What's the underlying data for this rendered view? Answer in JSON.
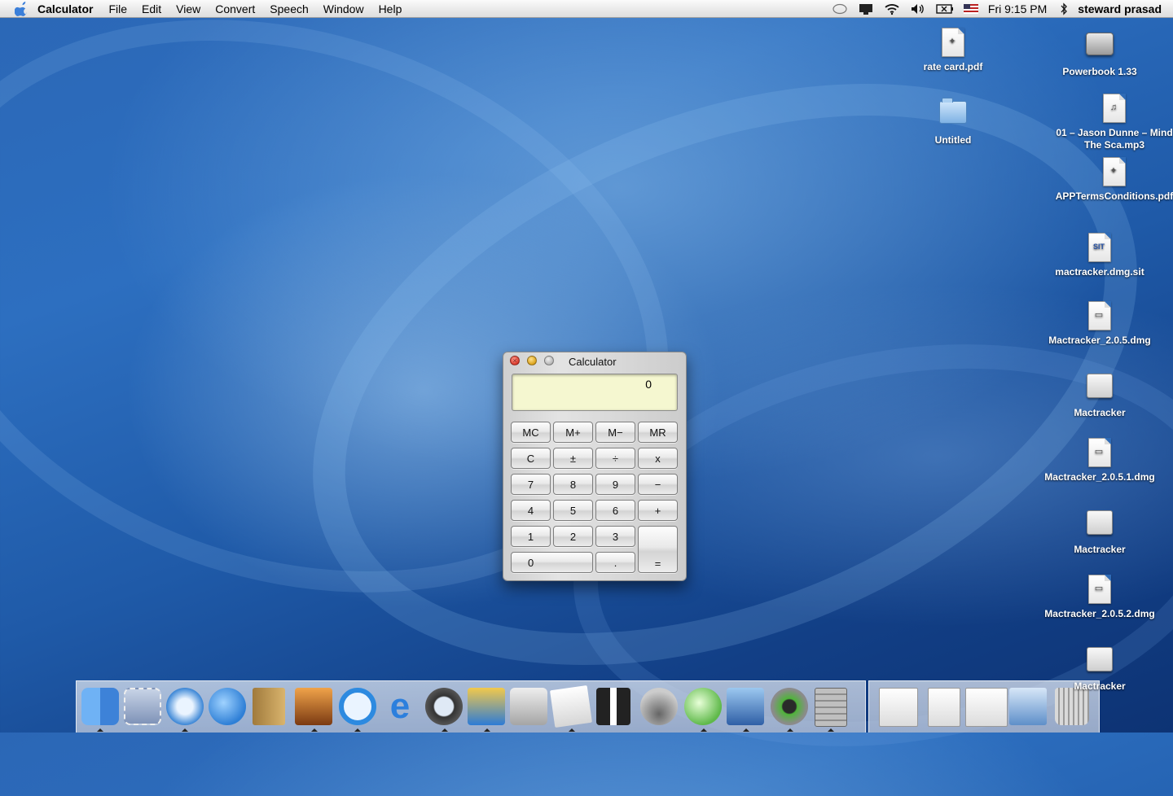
{
  "menubar": {
    "app_name": "Calculator",
    "menus": [
      "File",
      "Edit",
      "View",
      "Convert",
      "Speech",
      "Window",
      "Help"
    ],
    "clock": "Fri 9:15 PM",
    "user": "steward prasad",
    "status_icons": [
      "sync-icon",
      "display-icon",
      "wifi-icon",
      "volume-icon",
      "battery-icon",
      "flag-icon",
      "bluetooth-icon"
    ]
  },
  "desktop": {
    "icons": [
      {
        "label": "rate card.pdf",
        "kind": "pdf"
      },
      {
        "label": "Powerbook 1.33",
        "kind": "hard-drive"
      },
      {
        "label": "Untitled",
        "kind": "folder"
      },
      {
        "label": "01 – Jason Dunne – Mind The Sca.mp3",
        "kind": "mp3"
      },
      {
        "label": "APPTermsConditions.pdf",
        "kind": "pdf"
      },
      {
        "label": "mactracker.dmg.sit",
        "kind": "sit"
      },
      {
        "label": "Mactracker_2.0.5.dmg",
        "kind": "dmg"
      },
      {
        "label": "Mactracker",
        "kind": "disk"
      },
      {
        "label": "Mactracker_2.0.5.1.dmg",
        "kind": "dmg"
      },
      {
        "label": "Mactracker",
        "kind": "disk"
      },
      {
        "label": "Mactracker_2.0.5.2.dmg",
        "kind": "dmg"
      },
      {
        "label": "Mactracker",
        "kind": "disk"
      }
    ]
  },
  "calculator": {
    "title": "Calculator",
    "display": "0",
    "keys": {
      "mc": "MC",
      "mplus": "M+",
      "mminus": "M−",
      "mr": "MR",
      "clear": "C",
      "sign": "±",
      "divide": "÷",
      "multiply": "x",
      "seven": "7",
      "eight": "8",
      "nine": "9",
      "minus": "−",
      "four": "4",
      "five": "5",
      "six": "6",
      "plus": "+",
      "one": "1",
      "two": "2",
      "three": "3",
      "equals": "=",
      "zero": "0",
      "point": "."
    }
  },
  "dock": {
    "apps": [
      "Finder",
      "Mail Stamp",
      "Safari",
      "iChat",
      "Address Book",
      "iPhoto",
      "QuickTime",
      "Internet Explorer",
      "Sherlock",
      "iMovie",
      "System Preferences",
      "TextEdit",
      "Tux",
      "Network Utility",
      "iTunes",
      "Preview",
      "iPod Updater",
      "Calculator"
    ],
    "docs": [
      "Document 1",
      "Document 2",
      "Document 3",
      "Network",
      "Trash"
    ]
  }
}
